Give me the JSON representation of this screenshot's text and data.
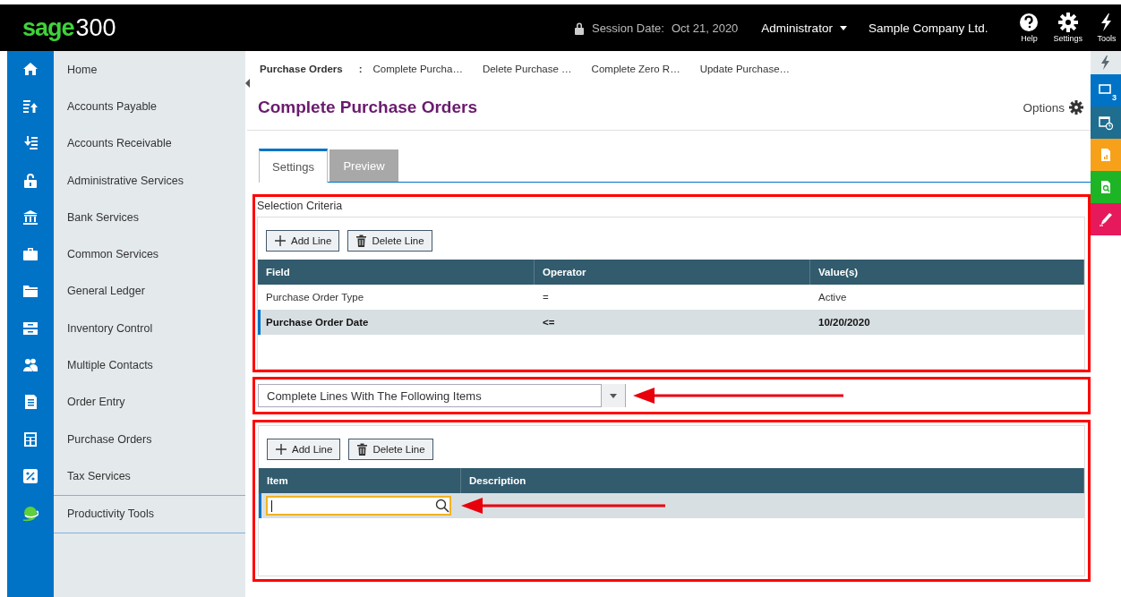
{
  "header": {
    "logo_brand": "sage",
    "logo_product": "300",
    "session_label": "Session Date:",
    "session_date": "Oct 21, 2020",
    "user": "Administrator",
    "company": "Sample Company Ltd.",
    "tools": [
      {
        "label": "Help",
        "kind": "help"
      },
      {
        "label": "Settings",
        "kind": "settings"
      },
      {
        "label": "Tools",
        "kind": "tools"
      }
    ]
  },
  "sidebar": {
    "items": [
      {
        "label": "Home",
        "kind": "home"
      },
      {
        "label": "Accounts Payable",
        "kind": "payable"
      },
      {
        "label": "Accounts Receivable",
        "kind": "receivable"
      },
      {
        "label": "Administrative Services",
        "kind": "lock"
      },
      {
        "label": "Bank Services",
        "kind": "bank"
      },
      {
        "label": "Common Services",
        "kind": "briefcase"
      },
      {
        "label": "General Ledger",
        "kind": "folder"
      },
      {
        "label": "Inventory Control",
        "kind": "boxes"
      },
      {
        "label": "Multiple Contacts",
        "kind": "people"
      },
      {
        "label": "Order Entry",
        "kind": "document"
      },
      {
        "label": "Purchase Orders",
        "kind": "grid"
      },
      {
        "label": "Tax Services",
        "kind": "percent"
      },
      {
        "label": "Productivity Tools",
        "kind": "globe"
      }
    ]
  },
  "breadcrumb": {
    "root": "Purchase Orders",
    "separator": ":",
    "items": [
      "Complete Purcha…",
      "Delete Purchase …",
      "Complete Zero R…",
      "Update Purchase…"
    ]
  },
  "page": {
    "title": "Complete Purchase Orders",
    "options_label": "Options"
  },
  "tabs": [
    {
      "label": "Settings",
      "selected": true
    },
    {
      "label": "Preview",
      "selected": false
    }
  ],
  "criteria": {
    "highlighted": true,
    "title": "Selection Criteria",
    "buttons": [
      {
        "label": "Add Line",
        "kind": "add"
      },
      {
        "label": "Delete Line",
        "kind": "delete"
      }
    ],
    "columns": [
      "Field",
      "Operator",
      "Value(s)"
    ],
    "rows": [
      {
        "cells": [
          "Purchase Order Type",
          "=",
          "Active"
        ],
        "selected": false
      },
      {
        "cells": [
          "Purchase Order Date",
          "<=",
          "10/20/2020"
        ],
        "selected": true
      }
    ]
  },
  "mode_dropdown": {
    "highlighted": true,
    "value": "Complete Lines With The Following Items",
    "arrow": true
  },
  "items_grid": {
    "highlighted": true,
    "buttons": [
      {
        "label": "Add Line",
        "kind": "add"
      },
      {
        "label": "Delete Line",
        "kind": "delete"
      }
    ],
    "columns": [
      "Item",
      "Description"
    ],
    "rows": [
      {
        "selected": true,
        "focused": true,
        "arrow": true
      }
    ]
  },
  "rail": [
    {
      "kind": "bolt",
      "color": "#e4e9ec"
    },
    {
      "kind": "windows",
      "color": "#0073c6",
      "badge": "3"
    },
    {
      "kind": "clock-window",
      "color": "#1f6d8f"
    },
    {
      "kind": "report",
      "color": "#f7a11a"
    },
    {
      "kind": "search-doc",
      "color": "#1db526"
    },
    {
      "kind": "pen",
      "color": "#e6195c"
    }
  ]
}
